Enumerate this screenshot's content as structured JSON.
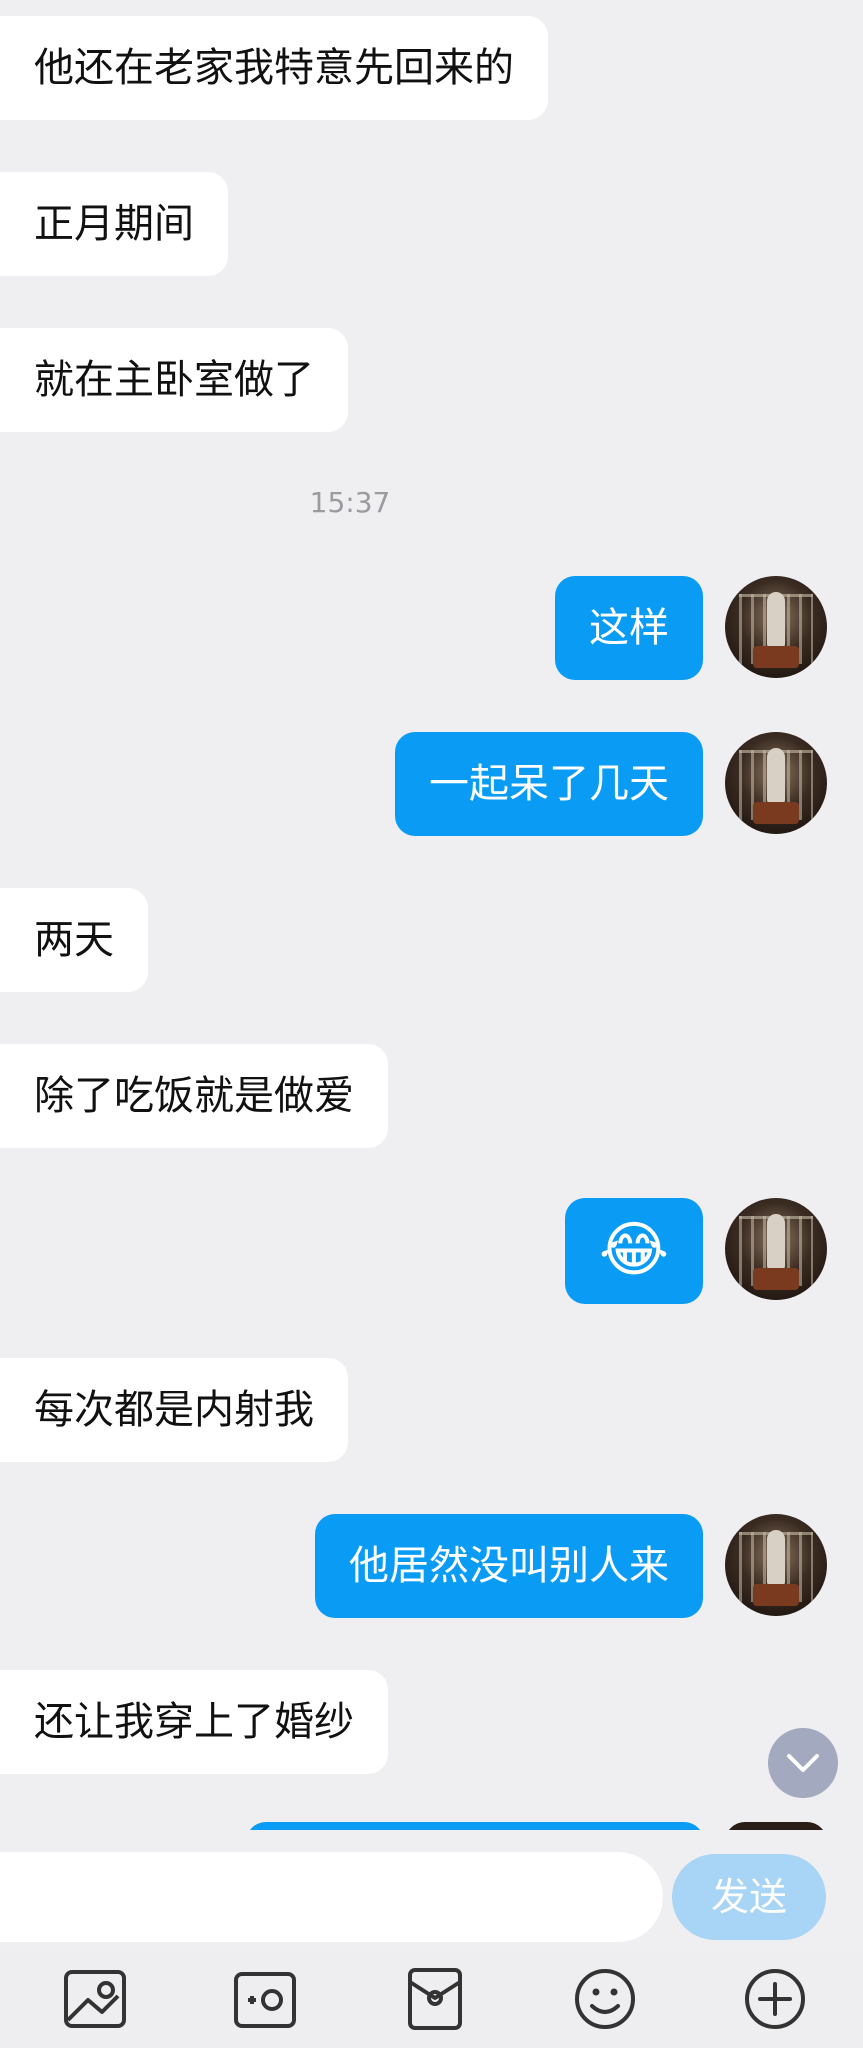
{
  "messages_incoming_1": "他还在老家我特意先回来的",
  "messages_incoming_2": "正月期间",
  "messages_incoming_3": "就在主卧室做了",
  "timestamp": "15:37",
  "messages_outgoing_1": "这样",
  "messages_outgoing_2": "一起呆了几天",
  "messages_incoming_4": "两天",
  "messages_incoming_5": "除了吃饭就是做爱",
  "messages_outgoing_3_emoji": "😂",
  "messages_incoming_6": "每次都是内射我",
  "messages_outgoing_4": "他居然没叫别人来",
  "messages_incoming_7": "还让我穿上了婚纱",
  "input": {
    "placeholder": "",
    "send_label": "发送"
  },
  "toolbar": {
    "icons": [
      "image-icon",
      "camera-icon",
      "red-packet-icon",
      "emoji-icon",
      "plus-icon"
    ]
  },
  "colors": {
    "background": "#efeff1",
    "outgoing_bubble": "#0a9bf5",
    "incoming_bubble": "#ffffff",
    "send_button": "#a8d4f5",
    "scroll_button": "#a3a9bf"
  }
}
